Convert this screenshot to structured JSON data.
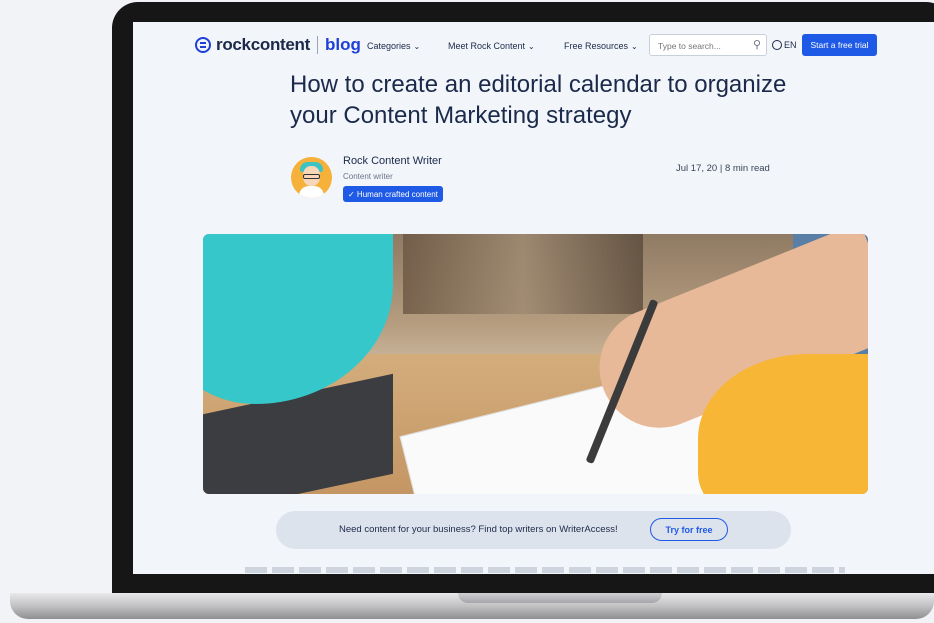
{
  "nav": {
    "logo_text": "rockcontent",
    "logo_blog": "blog",
    "items": [
      {
        "label": "Categories"
      },
      {
        "label": "Meet Rock Content"
      },
      {
        "label": "Free Resources"
      }
    ],
    "search_placeholder": "Type to search...",
    "language": "EN",
    "cta_label": "Start a free trial"
  },
  "article": {
    "title": "How to create an editorial calendar to organize your Content Marketing strategy",
    "author_name": "Rock Content Writer",
    "author_role": "Content writer",
    "badge": "✓ Human crafted content",
    "meta": "Jul 17, 20 | 8 min read"
  },
  "cta_banner": {
    "text": "Need content for your business? Find top writers on WriterAccess!",
    "button": "Try for free"
  },
  "colors": {
    "accent": "#1f5ae6",
    "text": "#1b2a4a",
    "page_bg": "#f2f5fa"
  }
}
